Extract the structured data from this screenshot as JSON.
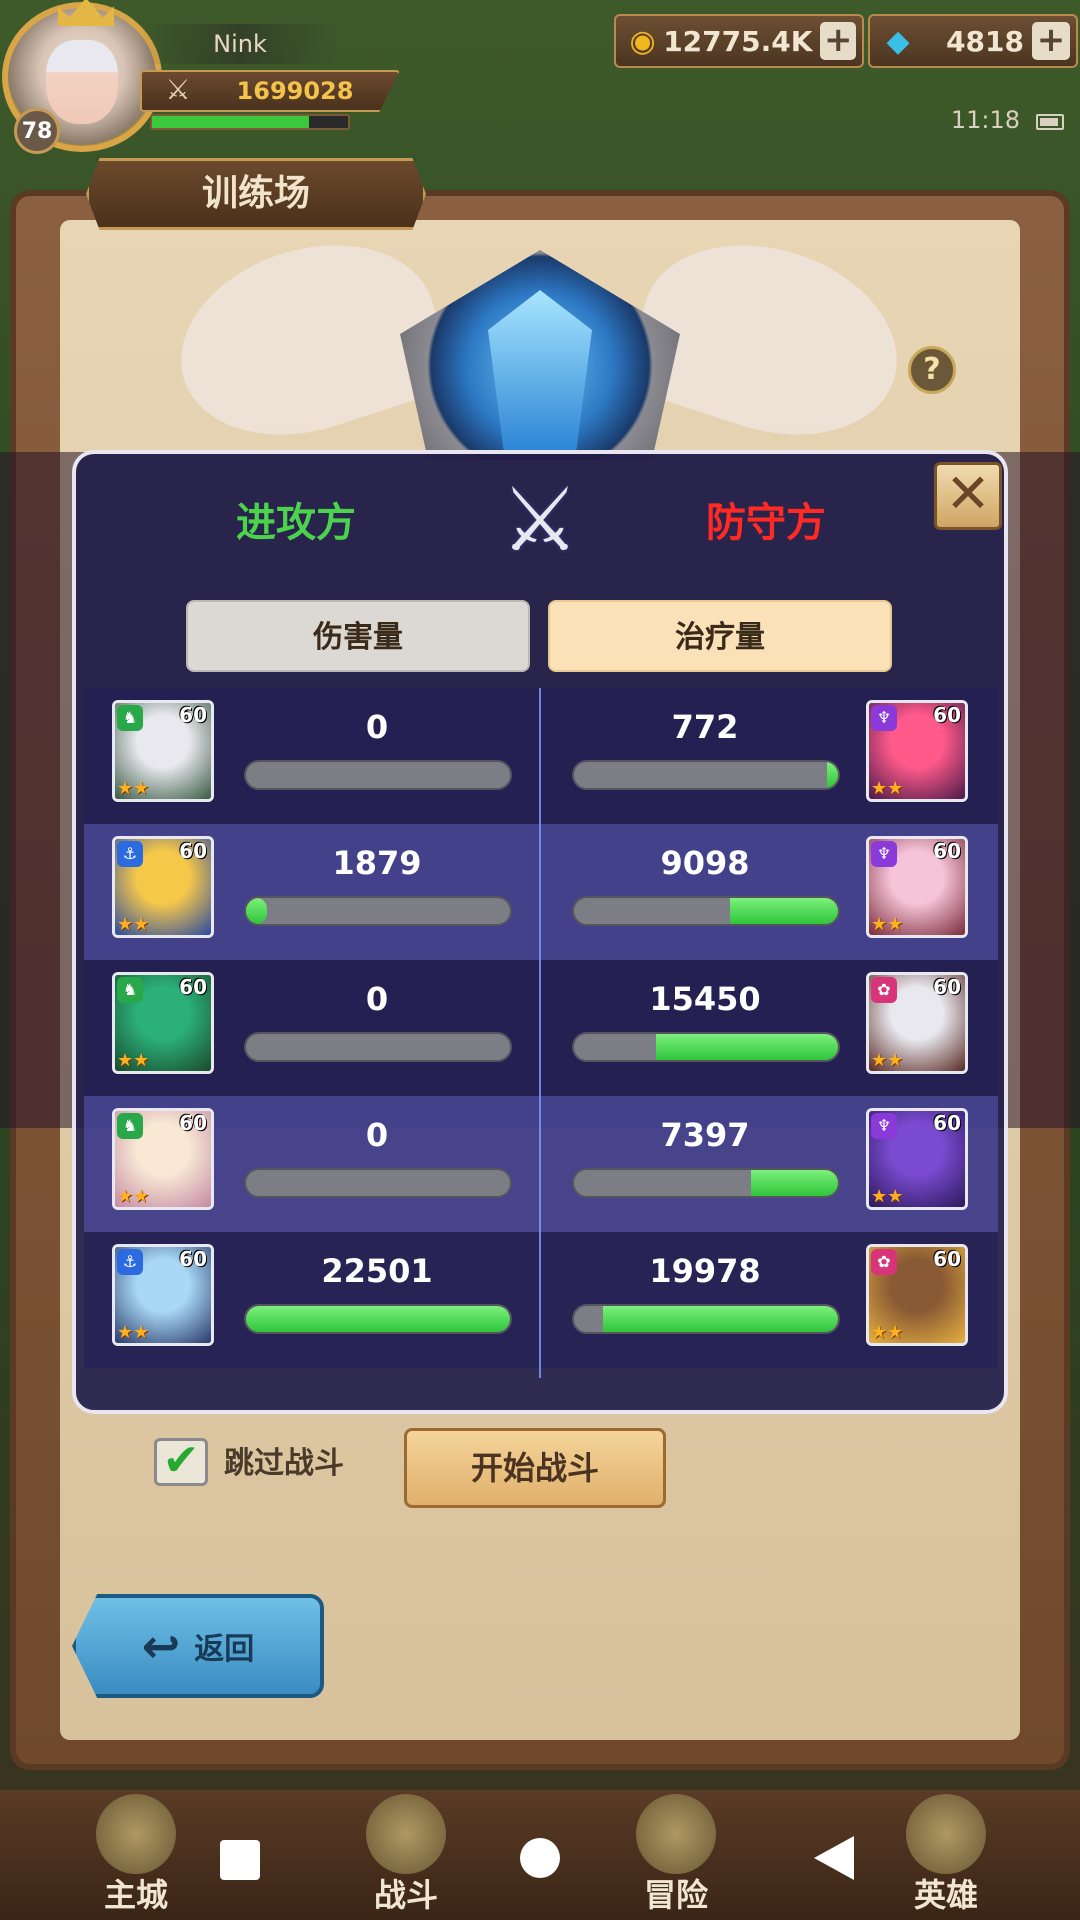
{
  "player": {
    "name": "Nink",
    "level": "78",
    "power": "1699028",
    "exp_fraction": 0.8
  },
  "currency": {
    "gold": "12775.4K",
    "gems": "4818"
  },
  "status_bar": {
    "time": "11:18"
  },
  "screen": {
    "title": "训练场"
  },
  "modal": {
    "attacker_label": "进攻方",
    "defender_label": "防守方",
    "tabs": {
      "damage": "伤害量",
      "heal": "治疗量"
    },
    "rows": [
      {
        "left": {
          "level": "60",
          "class": "green",
          "stars": "★★",
          "value": "0",
          "fraction": 0.0,
          "portrait": [
            "#e8e8ee",
            "#3a5a44"
          ]
        },
        "right": {
          "level": "60",
          "class": "purple",
          "stars": "★★",
          "value": "772",
          "fraction": 0.04,
          "portrait": [
            "#ff5a8a",
            "#4a1a4a"
          ]
        }
      },
      {
        "left": {
          "level": "60",
          "class": "blue",
          "stars": "★★",
          "value": "1879",
          "fraction": 0.08,
          "portrait": [
            "#f6c84a",
            "#2a4aa0"
          ]
        },
        "right": {
          "level": "60",
          "class": "purple",
          "stars": "★★",
          "value": "9098",
          "fraction": 0.41,
          "portrait": [
            "#f6c4d8",
            "#7a2a3a"
          ]
        }
      },
      {
        "left": {
          "level": "60",
          "class": "green",
          "stars": "★★",
          "value": "0",
          "fraction": 0.0,
          "portrait": [
            "#2bb07a",
            "#1a4a2a"
          ]
        },
        "right": {
          "level": "60",
          "class": "pink",
          "stars": "★★",
          "value": "15450",
          "fraction": 0.69,
          "portrait": [
            "#e8e8ee",
            "#5a2a24"
          ]
        }
      },
      {
        "left": {
          "level": "60",
          "class": "green",
          "stars": "★★",
          "value": "0",
          "fraction": 0.0,
          "portrait": [
            "#f8e8d4",
            "#c48aa4"
          ]
        },
        "right": {
          "level": "60",
          "class": "purple",
          "stars": "★★",
          "value": "7397",
          "fraction": 0.33,
          "portrait": [
            "#7a4ad0",
            "#2a1a5a"
          ]
        }
      },
      {
        "left": {
          "level": "60",
          "class": "blue",
          "stars": "★★",
          "value": "22501",
          "fraction": 1.0,
          "portrait": [
            "#a8d8f4",
            "#2a3a6a"
          ]
        },
        "right": {
          "level": "60",
          "class": "pink",
          "stars": "★★",
          "value": "19978",
          "fraction": 0.89,
          "portrait": [
            "#8a5a34",
            "#e6b040"
          ]
        }
      }
    ]
  },
  "controls": {
    "skip_battle_label": "跳过战斗",
    "skip_battle_checked": true,
    "start_battle_label": "开始战斗",
    "back_label": "返回"
  },
  "nav": {
    "items": [
      "主城",
      "战斗",
      "冒险",
      "英雄"
    ]
  },
  "colors": {
    "attacker": "#4bd44b",
    "defender": "#ff2a24",
    "bar_fill": "#2fc53a",
    "class_green": "#28a848",
    "class_blue": "#2c6ae0",
    "class_purple": "#8a3ad8",
    "class_pink": "#d8347a"
  }
}
